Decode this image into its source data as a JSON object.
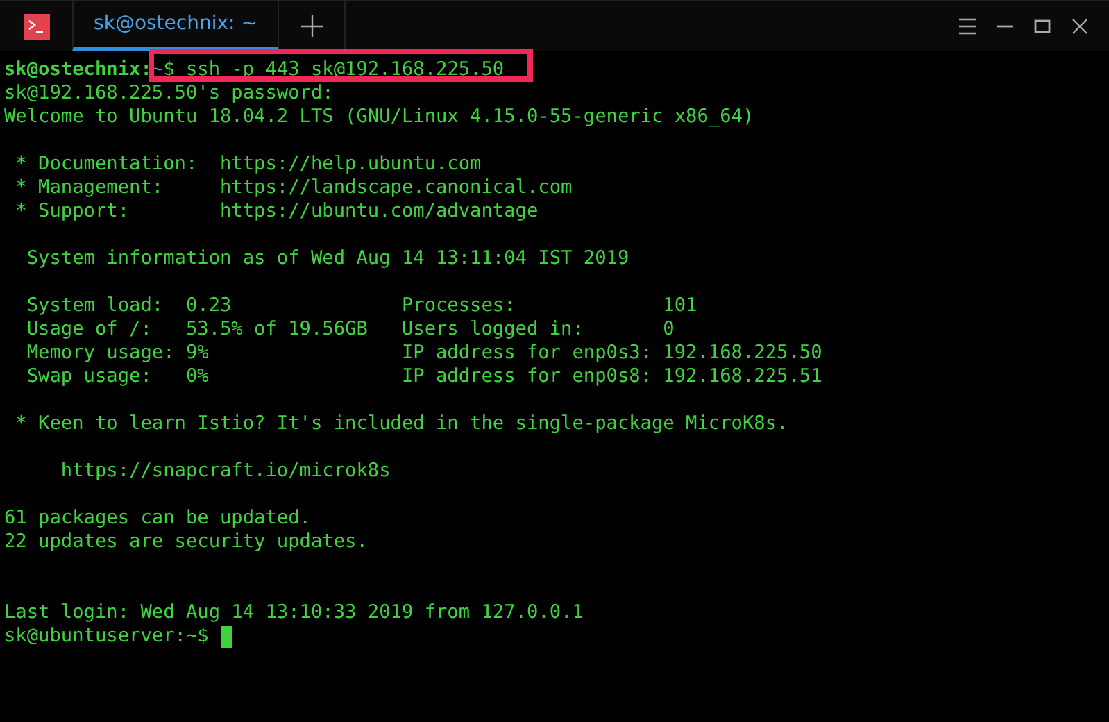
{
  "tabs": [
    {
      "label": "sk@ostechnix: ~",
      "selected": true
    }
  ],
  "lines": [
    {
      "kind": "command",
      "user": "sk@ostechnix:",
      "path": "~",
      "symbol": "$",
      "command": " ssh -p 443 sk@192.168.225.50",
      "highlighted": true
    },
    {
      "kind": "output",
      "text": "sk@192.168.225.50's password:"
    },
    {
      "kind": "output",
      "text": "Welcome to Ubuntu 18.04.2 LTS (GNU/Linux 4.15.0-55-generic x86_64)"
    },
    {
      "kind": "blank"
    },
    {
      "kind": "output",
      "text": " * Documentation:  https://help.ubuntu.com"
    },
    {
      "kind": "output",
      "text": " * Management:     https://landscape.canonical.com"
    },
    {
      "kind": "output",
      "text": " * Support:        https://ubuntu.com/advantage"
    },
    {
      "kind": "blank"
    },
    {
      "kind": "output",
      "text": "  System information as of Wed Aug 14 13:11:04 IST 2019"
    },
    {
      "kind": "blank"
    },
    {
      "kind": "output",
      "text": "  System load:  0.23               Processes:             101"
    },
    {
      "kind": "output",
      "text": "  Usage of /:   53.5% of 19.56GB   Users logged in:       0"
    },
    {
      "kind": "output",
      "text": "  Memory usage: 9%                 IP address for enp0s3: 192.168.225.50"
    },
    {
      "kind": "output",
      "text": "  Swap usage:   0%                 IP address for enp0s8: 192.168.225.51"
    },
    {
      "kind": "blank"
    },
    {
      "kind": "output",
      "text": " * Keen to learn Istio? It's included in the single-package MicroK8s."
    },
    {
      "kind": "blank"
    },
    {
      "kind": "output",
      "text": "     https://snapcraft.io/microk8s"
    },
    {
      "kind": "blank"
    },
    {
      "kind": "output",
      "text": "61 packages can be updated."
    },
    {
      "kind": "output",
      "text": "22 updates are security updates."
    },
    {
      "kind": "blank"
    },
    {
      "kind": "blank"
    },
    {
      "kind": "output",
      "text": "Last login: Wed Aug 14 13:10:33 2019 from 127.0.0.1"
    },
    {
      "kind": "prompt",
      "text": "sk@ubuntuserver:~$ ",
      "cursor": true
    }
  ]
}
